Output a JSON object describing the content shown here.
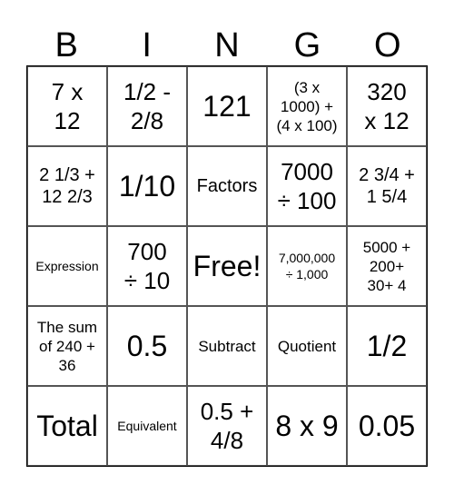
{
  "header": [
    "B",
    "I",
    "N",
    "G",
    "O"
  ],
  "cells": [
    {
      "text": "7 x\n12",
      "size": "s2"
    },
    {
      "text": "1/2 -\n2/8",
      "size": "s2"
    },
    {
      "text": "121",
      "size": "s1"
    },
    {
      "text": "(3 x\n1000) +\n(4 x 100)",
      "size": "s4"
    },
    {
      "text": "320\nx 12",
      "size": "s2"
    },
    {
      "text": "2 1/3 +\n12 2/3",
      "size": "s3"
    },
    {
      "text": "1/10",
      "size": "s1"
    },
    {
      "text": "Factors",
      "size": "s3"
    },
    {
      "text": "7000\n÷ 100",
      "size": "s2"
    },
    {
      "text": "2 3/4 +\n1 5/4",
      "size": "s3"
    },
    {
      "text": "Expression",
      "size": "s5"
    },
    {
      "text": "700\n÷ 10",
      "size": "s2"
    },
    {
      "text": "Free!",
      "size": "s1"
    },
    {
      "text": "7,000,000\n÷ 1,000",
      "size": "s5"
    },
    {
      "text": "5000 +\n200+\n30+ 4",
      "size": "s4"
    },
    {
      "text": "The sum\nof 240 +\n36",
      "size": "s4"
    },
    {
      "text": "0.5",
      "size": "s1"
    },
    {
      "text": "Subtract",
      "size": "s4"
    },
    {
      "text": "Quotient",
      "size": "s4"
    },
    {
      "text": "1/2",
      "size": "s1"
    },
    {
      "text": "Total",
      "size": "s1"
    },
    {
      "text": "Equivalent",
      "size": "s5"
    },
    {
      "text": "0.5 +\n4/8",
      "size": "s2"
    },
    {
      "text": "8 x 9",
      "size": "s1"
    },
    {
      "text": "0.05",
      "size": "s1"
    }
  ]
}
